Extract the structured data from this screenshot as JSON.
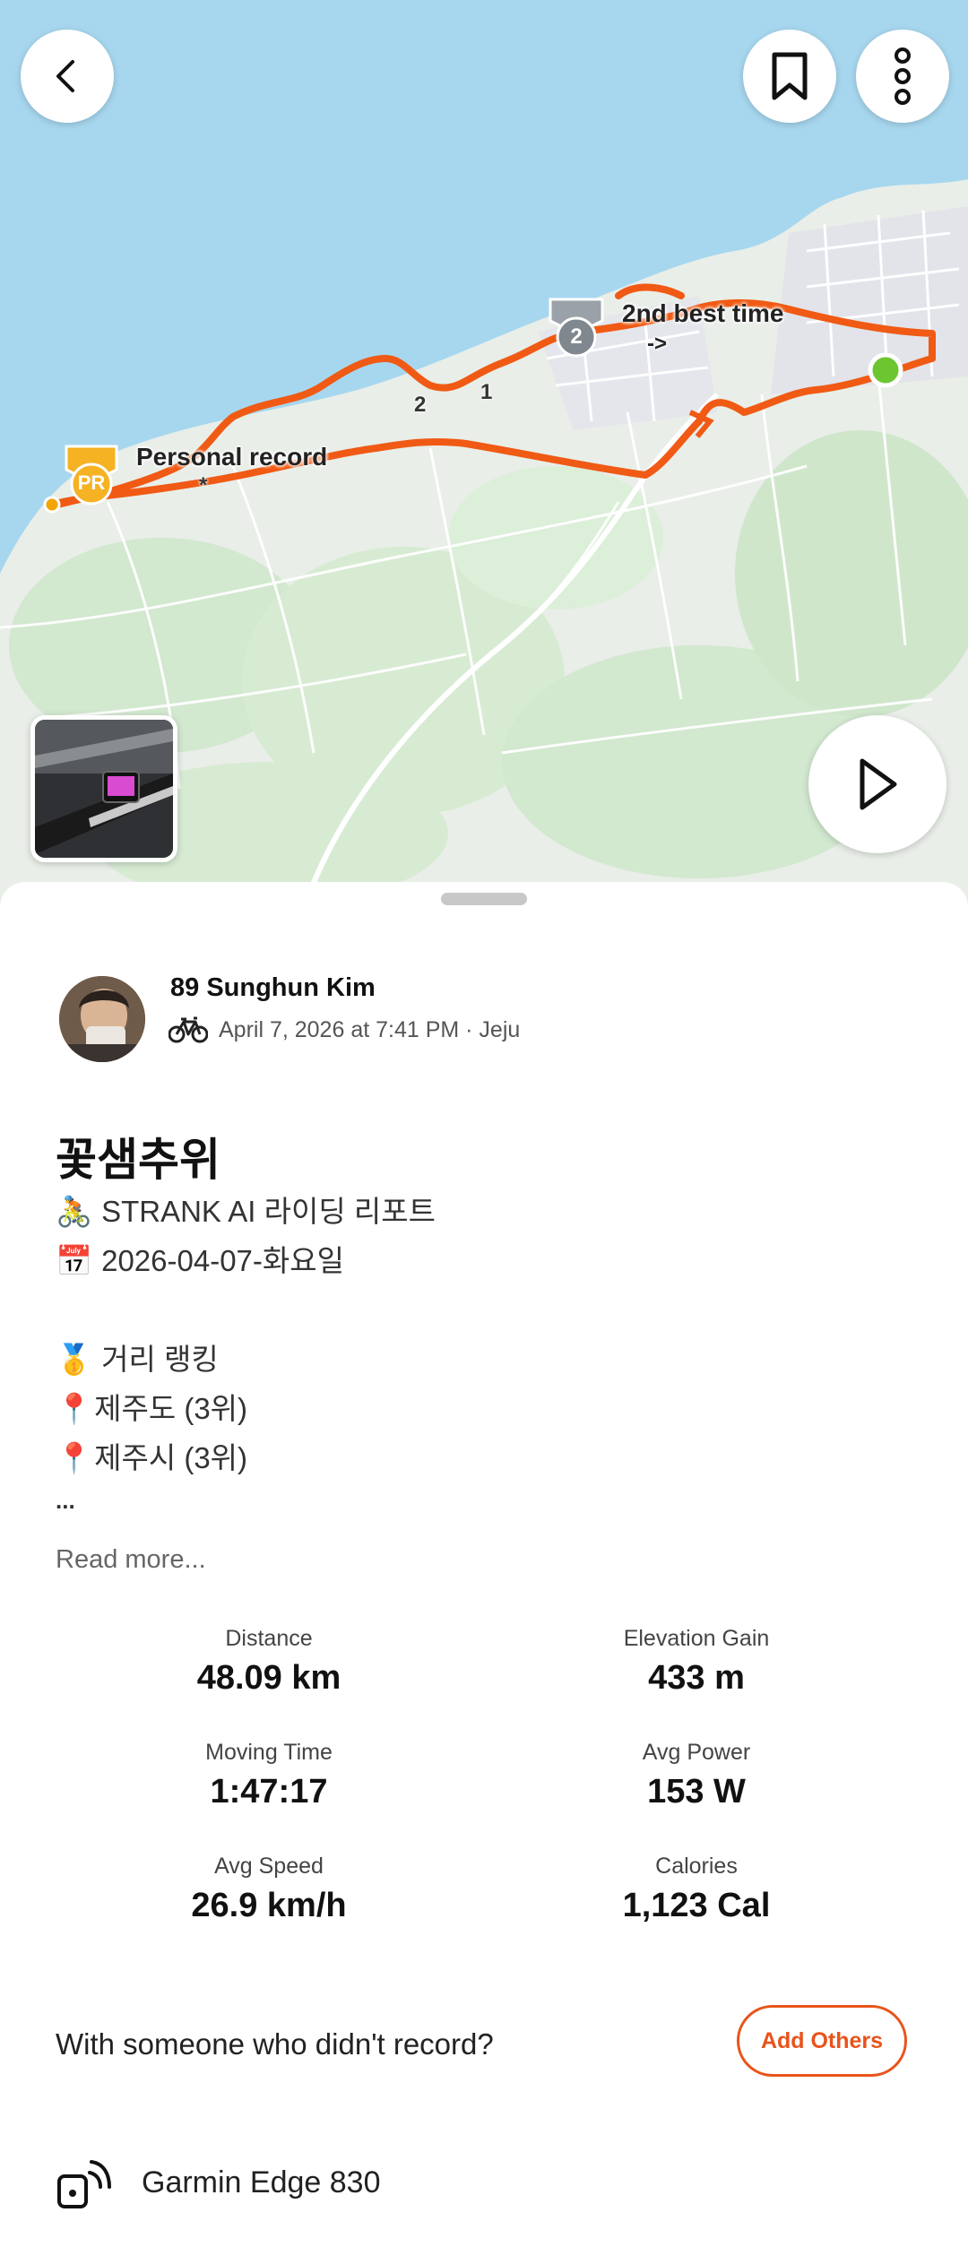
{
  "map": {
    "labels": {
      "personal_record": "Personal record",
      "second_best": "2nd best time",
      "arrow": "->",
      "star": "*",
      "lap_2": "2",
      "lap_1": "1"
    },
    "badges": {
      "pr": "PR",
      "rank": "2"
    },
    "colors": {
      "route": "#f05a14",
      "water": "#a7d7ef",
      "land": "#e8eee7",
      "finish": "#6cc632"
    }
  },
  "header": {
    "back_icon": "chevron-left-icon",
    "bookmark_icon": "bookmark-icon",
    "more_icon": "more-vertical-icon",
    "play_icon": "play-icon"
  },
  "activity": {
    "athlete_name": "89 Sunghun Kim",
    "sport_icon": "bicycle-icon",
    "date_location": "April 7, 2026 at 7:41 PM · Jeju",
    "title": "꽃샘추위",
    "description": [
      {
        "emoji": "🚴",
        "text": "STRANK AI 라이딩 리포트"
      },
      {
        "emoji": "📅",
        "text": "2026-04-07-화요일"
      },
      {
        "emoji": "",
        "text": ""
      },
      {
        "emoji": "🥇",
        "text": "거리 랭킹"
      },
      {
        "emoji": "📍",
        "text": "제주도 (3위)"
      },
      {
        "emoji": "📍",
        "text": "제주시 (3위)"
      },
      {
        "emoji": "",
        "text": "..."
      }
    ],
    "read_more": "Read more..."
  },
  "stats": [
    {
      "label": "Distance",
      "value": "48.09 km"
    },
    {
      "label": "Elevation Gain",
      "value": "433 m"
    },
    {
      "label": "Moving Time",
      "value": "1:47:17"
    },
    {
      "label": "Avg Power",
      "value": "153 W"
    },
    {
      "label": "Avg Speed",
      "value": "26.9 km/h"
    },
    {
      "label": "Calories",
      "value": "1,123 Cal"
    }
  ],
  "with_others": {
    "prompt": "With someone who didn't record?",
    "button": "Add Others"
  },
  "device": {
    "icon": "device-signal-icon",
    "name": "Garmin Edge 830"
  }
}
